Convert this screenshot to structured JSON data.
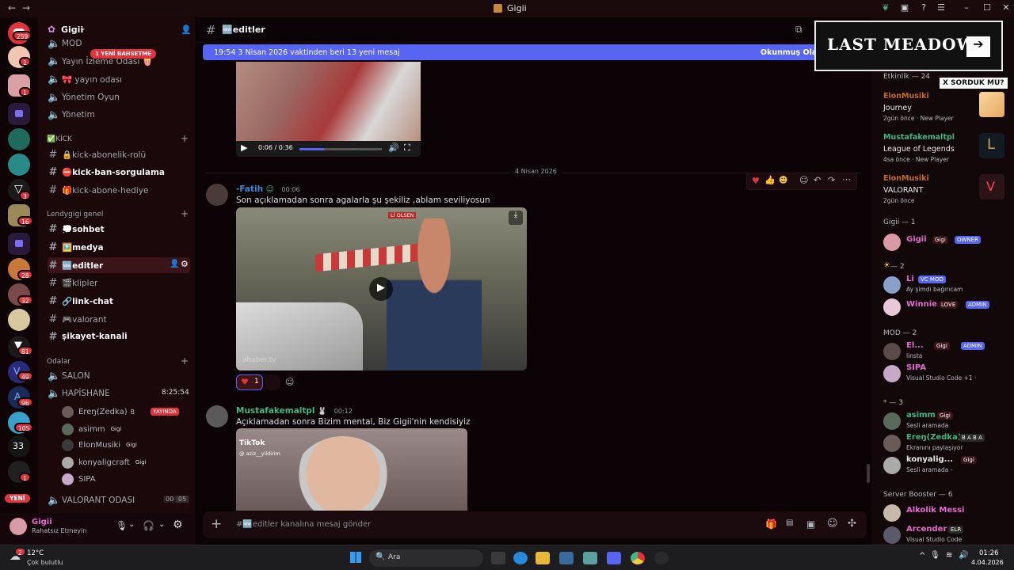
{
  "window": {
    "title": "Gigii"
  },
  "guild_rail": {
    "badges": [
      "259",
      "1",
      "1",
      "3",
      "16",
      "28",
      "32",
      "81",
      "49",
      "96",
      "105",
      "1"
    ],
    "server_33": "33",
    "yeni": "YENİ"
  },
  "server": {
    "name": "Gigii",
    "new_pill": "1 YENİ BAHSETME",
    "channels_top": [
      {
        "label": "MOD"
      },
      {
        "label": "Yayın İzleme Odası 🍿"
      },
      {
        "label": "🎀 yayın odası"
      },
      {
        "label": "Yönetim Oyun"
      },
      {
        "label": "Yönetim"
      }
    ],
    "cat_kick": "✅KİCK",
    "kick_channels": [
      "🔒kick-abonelik-rolü",
      "⛔kick-ban-sorgulama",
      "🎁kick-abone-hediye"
    ],
    "cat_general": "Lendygigi genel",
    "general_channels": [
      "💭sohbet",
      "🖼️medya",
      "🆕editler",
      "🎬klipler",
      "🔗link-chat",
      "🎮valorant",
      "şikayet-kanali"
    ],
    "cat_rooms": "Odalar",
    "rooms": [
      "SALON",
      "HAPİSHANE"
    ],
    "hapishane_timer": "8:25:54",
    "voice_users": [
      {
        "name": "Ereŋ(Zedka)",
        "tag": "B",
        "live": "YAYINDA"
      },
      {
        "name": "asimm",
        "tag": "Gigi"
      },
      {
        "name": "ElonMusiki",
        "tag": "Gigi"
      },
      {
        "name": "konyaligcraft",
        "tag": "Gigi"
      },
      {
        "name": "SIPA"
      }
    ],
    "valorant_room": "VALORANT ODASI",
    "valorant_counts": [
      "00",
      "05"
    ]
  },
  "user_panel": {
    "name": "Gigii",
    "status": "Rahatsız Etmeyin"
  },
  "chat": {
    "channel": "🆕editler",
    "new_messages": "19:54 3 Nisan 2026 vaktinden beri 13 yeni mesaj",
    "mark_read": "Okunmuş Olarak",
    "video1_time": "0:06 / 0:36",
    "date_divider": "4 Nisan 2026",
    "messages": [
      {
        "author": "-Fatih",
        "time": "00:06",
        "text": "Son açıklamadan sonra agalarla şu şekiliz ,ablam seviliyosun",
        "reaction_count": "1",
        "video_sign": "Lİ OLSEN",
        "watermark": "ahaber.tv"
      },
      {
        "author": "Mustafakemaltpl",
        "time": "00:12",
        "text": "Açıklamadan sonra Bizim mental, Biz Gigii'nin kendisiyiz",
        "tiktok": "TikTok",
        "tiktok_user": "@ aziz__yildirim"
      }
    ],
    "composer_placeholder": "#🆕editler kanalına mesaj gönder"
  },
  "ad": {
    "title": "LAST MEADOW",
    "tooltip": "X SORDUK MU?"
  },
  "members": {
    "activity_header": "Etkinlik — 24",
    "activities": [
      {
        "user": "ElonMusiki",
        "game": "Journey",
        "time": "2gün önce",
        "extra": "New Player"
      },
      {
        "user": "Mustafakemaltpl",
        "game": "League of Legends",
        "time": "4sa önce",
        "extra": "New Player"
      },
      {
        "user": "ElonMusiki",
        "game": "VALORANT",
        "time": "2gün önce",
        "extra": ""
      }
    ],
    "groups": [
      {
        "header": "Gigii — 1",
        "rows": [
          {
            "name": "Gigii",
            "tag": "Gigi",
            "role": "OWNER",
            "sub": ""
          }
        ]
      },
      {
        "header": "— 2",
        "rows": [
          {
            "name": "Li",
            "tag": "",
            "role": "VC MOD",
            "sub": "Ay şimdi bağırıcam"
          },
          {
            "name": "Winnie",
            "tag": "LOVE",
            "role": "ADMIN",
            "sub": ""
          }
        ]
      },
      {
        "header": "MOD — 2",
        "rows": [
          {
            "name": "El...",
            "tag": "Gigi",
            "role": "ADMIN",
            "sub": "linsta"
          },
          {
            "name": "SIPA",
            "tag": "",
            "role": "",
            "sub": "Visual Studio Code +1 ·"
          }
        ]
      },
      {
        "header": "* — 3",
        "rows": [
          {
            "name": "asimm",
            "tag": "Gigi",
            "role": "",
            "sub": "Sesli aramada"
          },
          {
            "name": "Ereŋ(Zedka)",
            "tag": "B A B A",
            "role": "",
            "sub": "Ekranını paylaşıyor"
          },
          {
            "name": "konyalig...",
            "tag": "Gigi",
            "role": "",
            "sub": "Sesli aramada -"
          }
        ]
      },
      {
        "header": "Server Booster — 6",
        "rows": [
          {
            "name": "Alkolik Messi",
            "tag": "",
            "role": "",
            "sub": ""
          },
          {
            "name": "Arcender",
            "tag": "ELR",
            "role": "",
            "sub": "Visual Studio Code"
          }
        ]
      }
    ]
  },
  "taskbar": {
    "weather_temp": "12°C",
    "weather_desc": "Çok bulutlu",
    "weather_badge": "2",
    "search": "Ara",
    "time": "01:26",
    "date": "4.04.2026"
  }
}
